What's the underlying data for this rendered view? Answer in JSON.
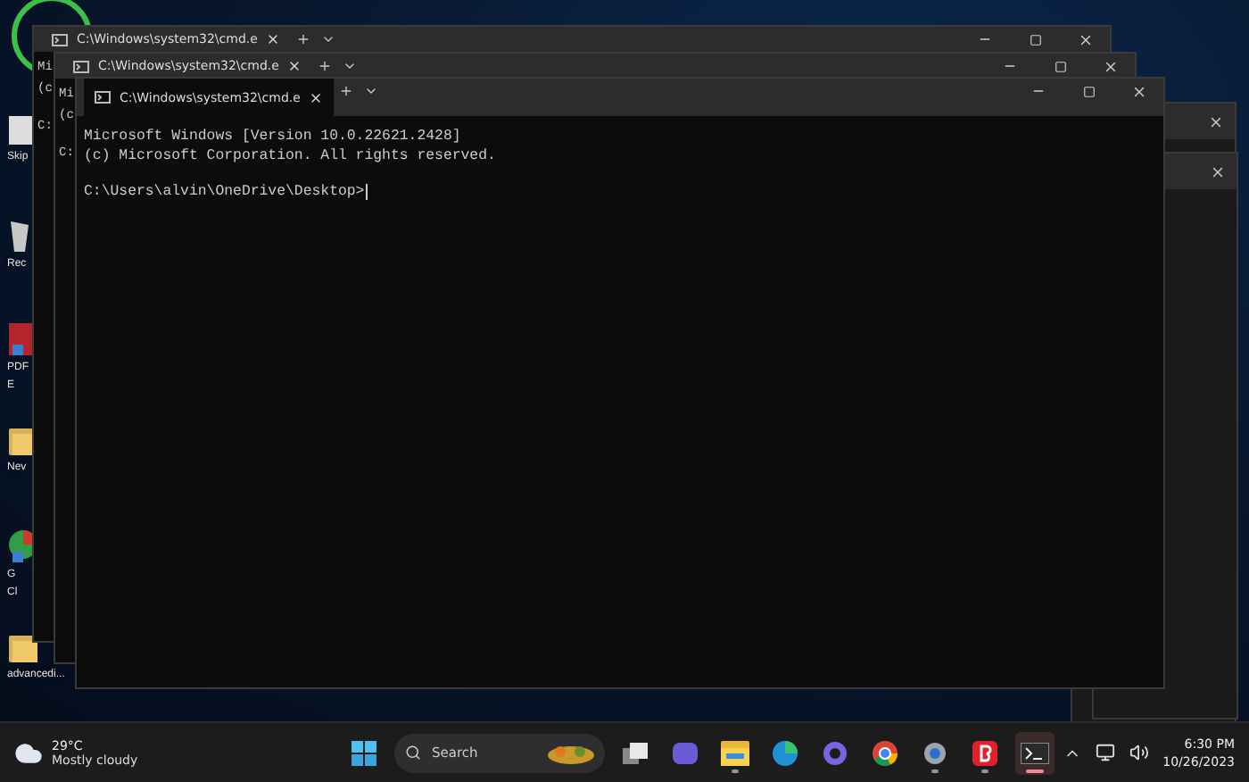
{
  "desktop_icons": [
    {
      "kind": "app",
      "lines": [
        "Skip"
      ]
    },
    {
      "kind": "recycle",
      "lines": [
        "Rec"
      ]
    },
    {
      "kind": "pdf",
      "lines": [
        "PDF",
        "E"
      ]
    },
    {
      "kind": "folder",
      "lines": [
        "Nev"
      ]
    },
    {
      "kind": "chrome",
      "lines": [
        "G",
        "Cl"
      ]
    },
    {
      "kind": "folder",
      "lines": [
        "advancedi..."
      ]
    }
  ],
  "windows": [
    {
      "tab_title": "C:\\Windows\\system32\\cmd.e",
      "lines": [
        "Mi",
        "(c"
      ],
      "prompt": "C:",
      "active": false
    },
    {
      "tab_title": "C:\\Windows\\system32\\cmd.e",
      "lines": [
        "Mi",
        "(c"
      ],
      "prompt": "C:",
      "active": false
    },
    {
      "tab_title": "C:\\Windows\\system32\\cmd.e",
      "lines": [
        "Microsoft Windows [Version 10.0.22621.2428]",
        "(c) Microsoft Corporation. All rights reserved."
      ],
      "prompt": "C:\\Users\\alvin\\OneDrive\\Desktop>",
      "active": true
    }
  ],
  "taskbar": {
    "weather": {
      "temperature": "29°C",
      "condition": "Mostly cloudy"
    },
    "search": {
      "placeholder": "Search"
    },
    "apps": [
      {
        "kind": "task-view",
        "running": false,
        "active": false
      },
      {
        "kind": "meet",
        "running": false,
        "active": false
      },
      {
        "kind": "folder",
        "running": true,
        "active": false
      },
      {
        "kind": "edge",
        "running": false,
        "active": false
      },
      {
        "kind": "copilot",
        "running": false,
        "active": false
      },
      {
        "kind": "chrome",
        "running": false,
        "active": false
      },
      {
        "kind": "settings",
        "running": true,
        "active": false
      },
      {
        "kind": "b-app",
        "running": true,
        "active": false
      },
      {
        "kind": "terminal",
        "running": true,
        "active": true
      }
    ],
    "clock": {
      "time": "6:30 PM",
      "date": "10/26/2023"
    }
  }
}
